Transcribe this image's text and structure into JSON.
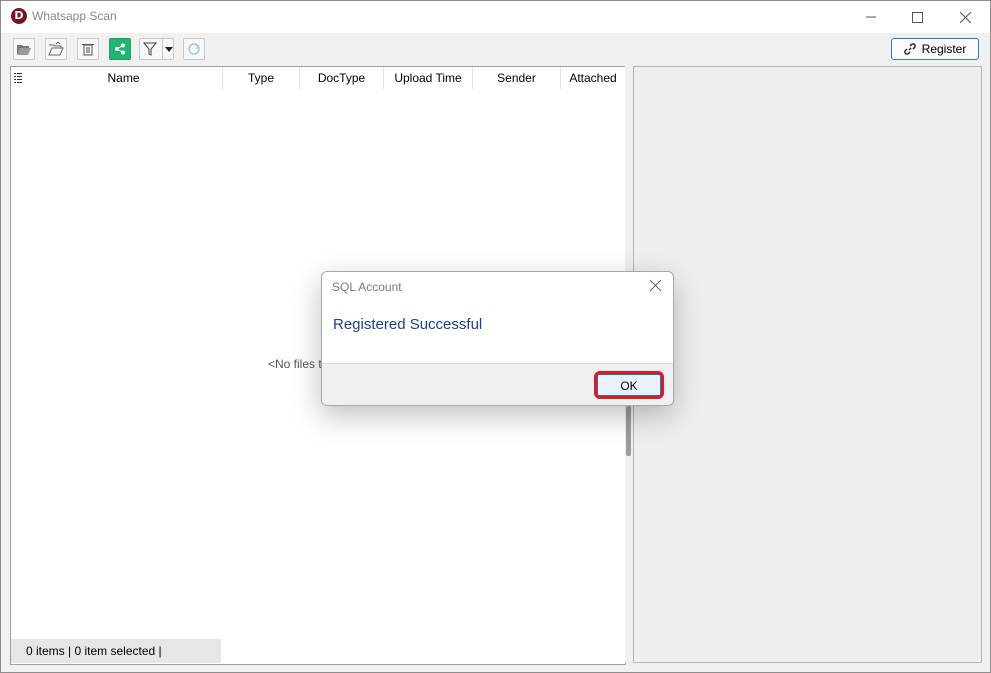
{
  "app": {
    "title": "Whatsapp Scan",
    "icon_letter": "D"
  },
  "titlebar": {
    "min_icon": "minimize-icon",
    "max_icon": "maximize-icon",
    "close_icon": "close-icon"
  },
  "toolbar": {
    "items": [
      {
        "icon": "open-folder-icon"
      },
      {
        "icon": "open-folder-outline-icon"
      },
      {
        "icon": "trash-icon"
      },
      {
        "icon": "share-icon",
        "color": "#21b573"
      },
      {
        "icon": "filter-icon"
      },
      {
        "icon": "refresh-icon"
      }
    ],
    "register_label": "Register",
    "register_icon": "link-icon"
  },
  "grid": {
    "columns": [
      "Name",
      "Type",
      "DocType",
      "Upload Time",
      "Sender",
      "Attached"
    ],
    "empty_text": "<No files t"
  },
  "status": {
    "text": "0 items |  0 item selected |"
  },
  "dialog": {
    "title": "SQL Account",
    "message": "Registered Successful",
    "ok_label": "OK",
    "highlight_color": "#e0181f"
  }
}
